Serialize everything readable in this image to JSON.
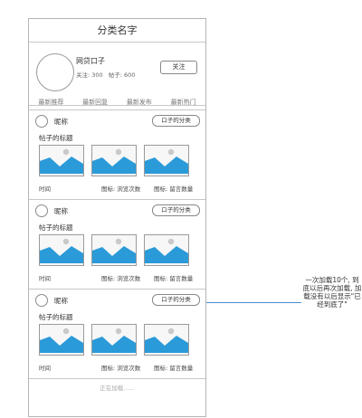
{
  "header": {
    "title": "分类名字"
  },
  "profile": {
    "name": "网贷口子",
    "follow_label": "关注: 300",
    "posts_label": "帖子: 600",
    "follow_button": "关注"
  },
  "tabs": [
    {
      "label": "最新推荐"
    },
    {
      "label": "最新回复"
    },
    {
      "label": "最新发布"
    },
    {
      "label": "最新热门"
    }
  ],
  "posts": [
    {
      "nickname": "昵称",
      "category": "口子的分类",
      "title": "帖子的标题",
      "time": "时间",
      "views": "图标: 浏览次数",
      "comments": "图标: 留言数量"
    },
    {
      "nickname": "昵称",
      "category": "口子的分类",
      "title": "帖子的标题",
      "time": "时间",
      "views": "图标: 浏览次数",
      "comments": "图标: 留言数量"
    },
    {
      "nickname": "昵称",
      "category": "口子的分类",
      "title": "帖子的标题",
      "time": "时间",
      "views": "图标: 浏览次数",
      "comments": "图标: 留言数量"
    }
  ],
  "loading": "正在加载......",
  "annotation": "一次加载10个, 到底以后再次加载, 加载没有以后显示\"已经到底了\"",
  "colors": {
    "image_blue": "#2b9ad8",
    "annotation_line": "#4a8fd1"
  }
}
